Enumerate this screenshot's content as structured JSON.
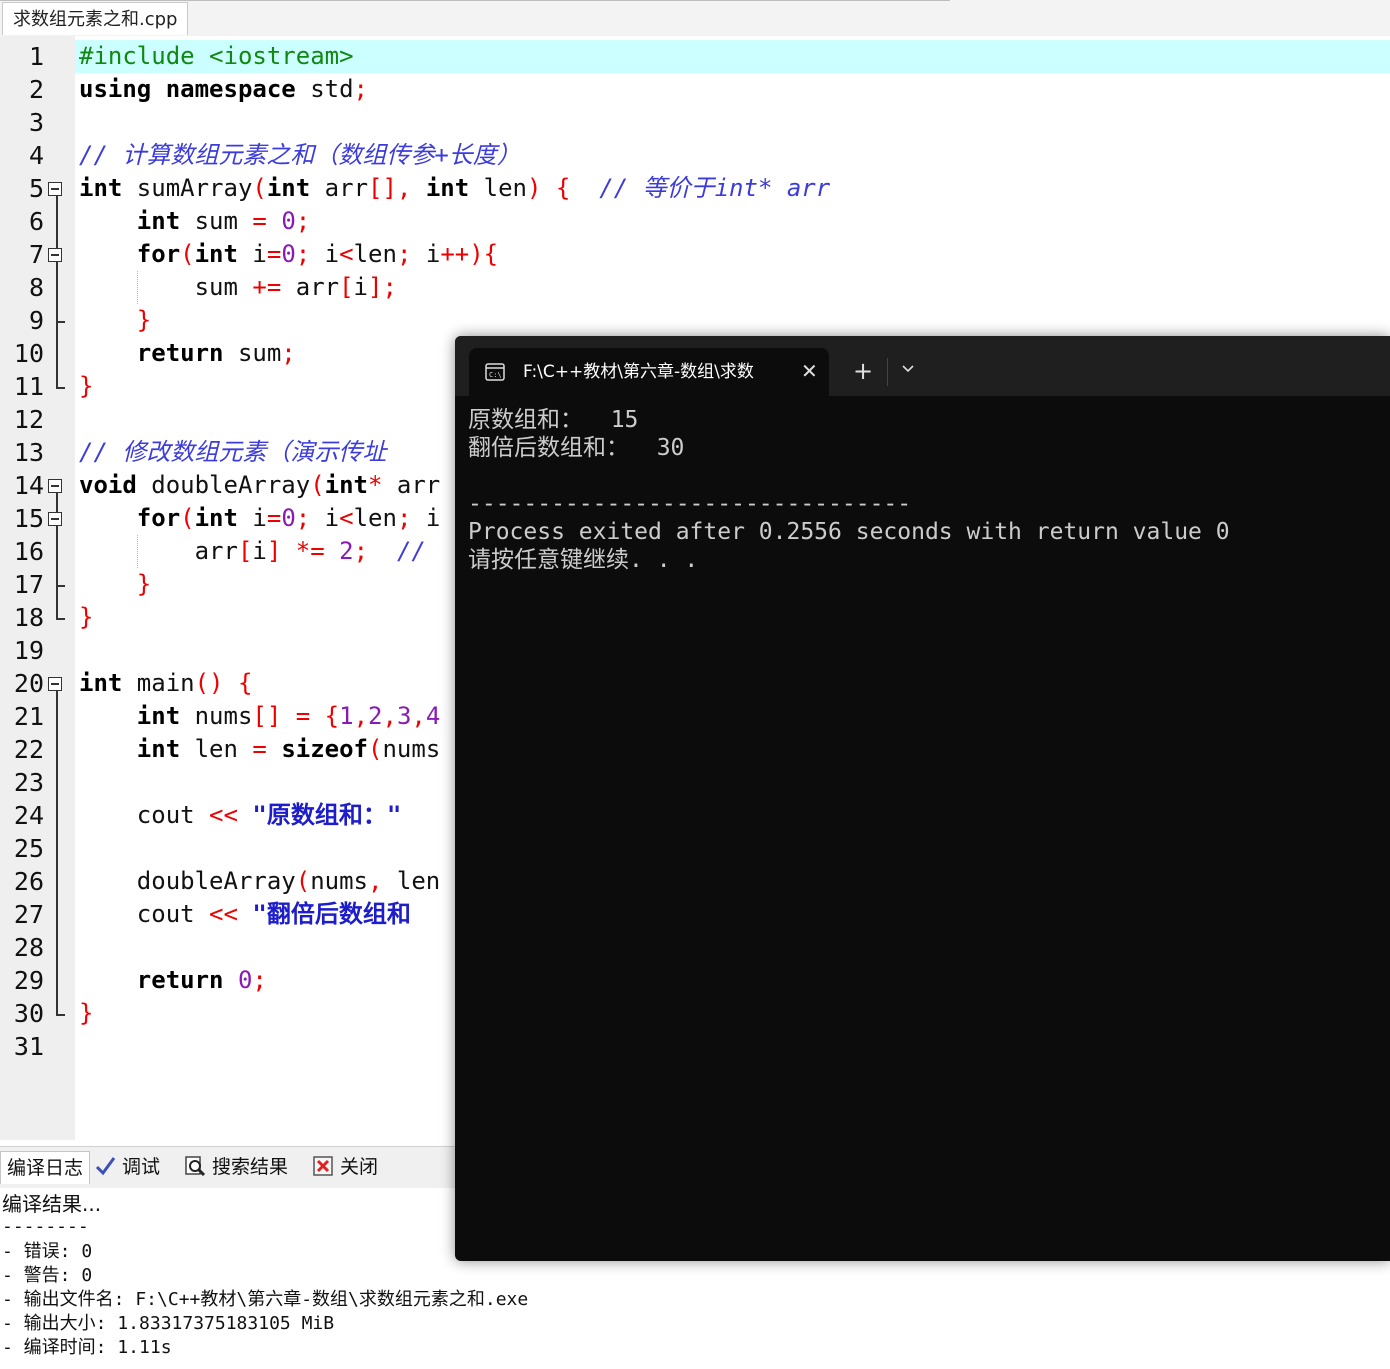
{
  "editor_tab": {
    "filename": "求数组元素之和.cpp"
  },
  "gutter": {
    "line_numbers": [
      "1",
      "2",
      "3",
      "4",
      "5",
      "6",
      "7",
      "8",
      "9",
      "10",
      "11",
      "12",
      "13",
      "14",
      "15",
      "16",
      "17",
      "18",
      "19",
      "20",
      "21",
      "22",
      "23",
      "24",
      "25",
      "26",
      "27",
      "28",
      "29",
      "30",
      "31"
    ]
  },
  "code": {
    "l1": "#include <iostream>",
    "l2_kw": "using namespace",
    "l2_rest": " std",
    "l4": "// 计算数组元素之和（数组传参+长度）",
    "l5": {
      "k1": "int",
      "name": " sumArray",
      "k2": "int",
      "p1": " arr",
      "k3": "int",
      "p2": " len",
      "comment": "// 等价于int* arr"
    },
    "l6": {
      "k": "int",
      "rest": " sum ",
      "num": "0"
    },
    "l7": {
      "k1": "for",
      "k2": "int",
      "a": " i",
      "n": "0",
      "b": " i",
      "c": "len",
      "d": " i"
    },
    "l8": {
      "a": "sum ",
      "b": " arr",
      "c": "i"
    },
    "l10": {
      "k": "return",
      "rest": " sum"
    },
    "l13": "// 修改数组元素（演示传址",
    "l14": {
      "k1": "void",
      "name": " doubleArray",
      "k2": "int",
      "rest": " arr"
    },
    "l15": {
      "k1": "for",
      "k2": "int",
      "a": " i",
      "n": "0",
      "b": " i",
      "c": "len",
      "d": " i"
    },
    "l16": {
      "a": "arr",
      "b": "i",
      "n": "2",
      "comment": "//"
    },
    "l20": {
      "k": "int",
      "rest": " main"
    },
    "l21": {
      "k": "int",
      "a": " nums",
      "nums": [
        "1",
        "2",
        "3",
        "4"
      ]
    },
    "l22": {
      "k": "int",
      "a": " len ",
      "k2": "sizeof",
      "b": "nums"
    },
    "l24": {
      "a": "cout ",
      "s": "\"原数组和：\""
    },
    "l26": {
      "a": "doubleArray",
      "b": "nums",
      "c": " len"
    },
    "l27": {
      "a": "cout ",
      "s": "\"翻倍后数组和"
    },
    "l29": {
      "k": "return",
      "n": "0"
    }
  },
  "bottom_panel": {
    "tabs": [
      "编译日志",
      "调试",
      "搜索结果",
      "关闭"
    ],
    "log": [
      "编译结果...",
      "--------",
      "- 错误: 0",
      "- 警告: 0",
      "- 输出文件名: F:\\C++教材\\第六章-数组\\求数组元素之和.exe",
      "- 输出大小: 1.83317375183105 MiB",
      "- 编译时间: 1.11s"
    ]
  },
  "console": {
    "tab_title": "F:\\C++教材\\第六章-数组\\求数",
    "close_glyph": "✕",
    "new_tab_glyph": "+",
    "lines": [
      "原数组和：  15",
      "翻倍后数组和：  30",
      "",
      "--------------------------------",
      "Process exited after 0.2556 seconds with return value 0",
      "请按任意键继续. . ."
    ],
    "background_color": "#0c0c0c",
    "text_color": "#cccccc"
  },
  "colors": {
    "current_line": "#ccffff",
    "preprocessor": "#118811",
    "comment": "#3c3cdb",
    "symbol": "#ee0000",
    "number": "#8a1ab8",
    "string": "#1d1dcc"
  }
}
